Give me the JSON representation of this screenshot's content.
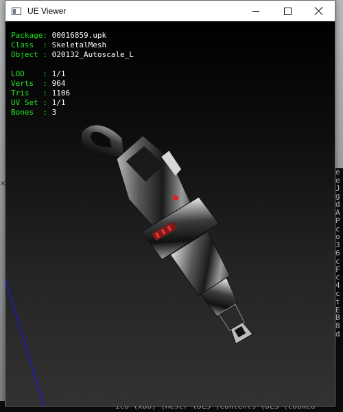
{
  "window": {
    "title": "UE Viewer"
  },
  "info": {
    "package_label": "Package:",
    "package": "00016859.upk",
    "class_label": "Class  :",
    "class": "SkeletalMesh",
    "object_label": "Object :",
    "object": "020132_Autoscale_L",
    "lod_label": "LOD    :",
    "lod": "1/1",
    "verts_label": "Verts  :",
    "verts": "964",
    "tris_label": "Tris   :",
    "tris": "1106",
    "uvset_label": "UV Set :",
    "uvset": "1/1",
    "bones_label": "Bones  :",
    "bones": "3"
  },
  "colors": {
    "label": "#23e523",
    "value": "#ffffff",
    "axis": "#1a1ad0"
  },
  "background": {
    "console_lines": [
      "e",
      "e",
      "J",
      "g",
      "d",
      "A",
      "P",
      "c",
      "o",
      "3",
      "6",
      "c",
      "F",
      "c",
      "4",
      "c",
      "t",
      "E",
      "B",
      "8",
      "d"
    ],
    "bottom_text": "ico (xbo) (Rescr (DLS (Contents (DLS (cooked"
  }
}
